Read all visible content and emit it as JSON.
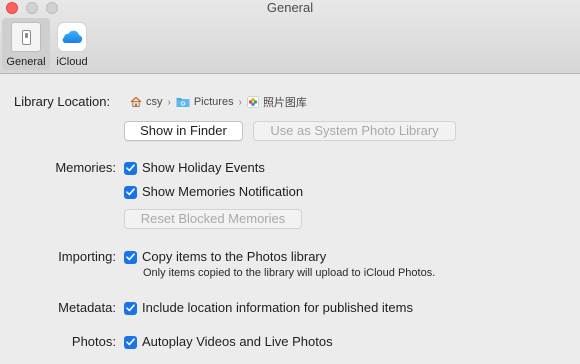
{
  "window": {
    "title": "General"
  },
  "toolbar": {
    "tabs": [
      {
        "label": "General",
        "icon": "general-switch-icon",
        "selected": true
      },
      {
        "label": "iCloud",
        "icon": "icloud-icon",
        "selected": false
      }
    ]
  },
  "library": {
    "label": "Library Location:",
    "path": [
      {
        "label": "csy",
        "icon": "home-icon"
      },
      {
        "label": "Pictures",
        "icon": "folder-icon"
      },
      {
        "label": "照片图库",
        "icon": "photos-library-icon"
      }
    ],
    "show_in_finder": "Show in Finder",
    "use_as_system": "Use as System Photo Library"
  },
  "memories": {
    "label": "Memories:",
    "show_holiday": "Show Holiday Events",
    "show_notification": "Show Memories Notification",
    "reset_blocked": "Reset Blocked Memories"
  },
  "importing": {
    "label": "Importing:",
    "copy_items": "Copy items to the Photos library",
    "note": "Only items copied to the library will upload to iCloud Photos."
  },
  "metadata": {
    "label": "Metadata:",
    "include_location": "Include location information for published items"
  },
  "photos": {
    "label": "Photos:",
    "autoplay": "Autoplay Videos and Live Photos"
  },
  "colors": {
    "accent": "#1a73e8",
    "close": "#fc605c"
  }
}
